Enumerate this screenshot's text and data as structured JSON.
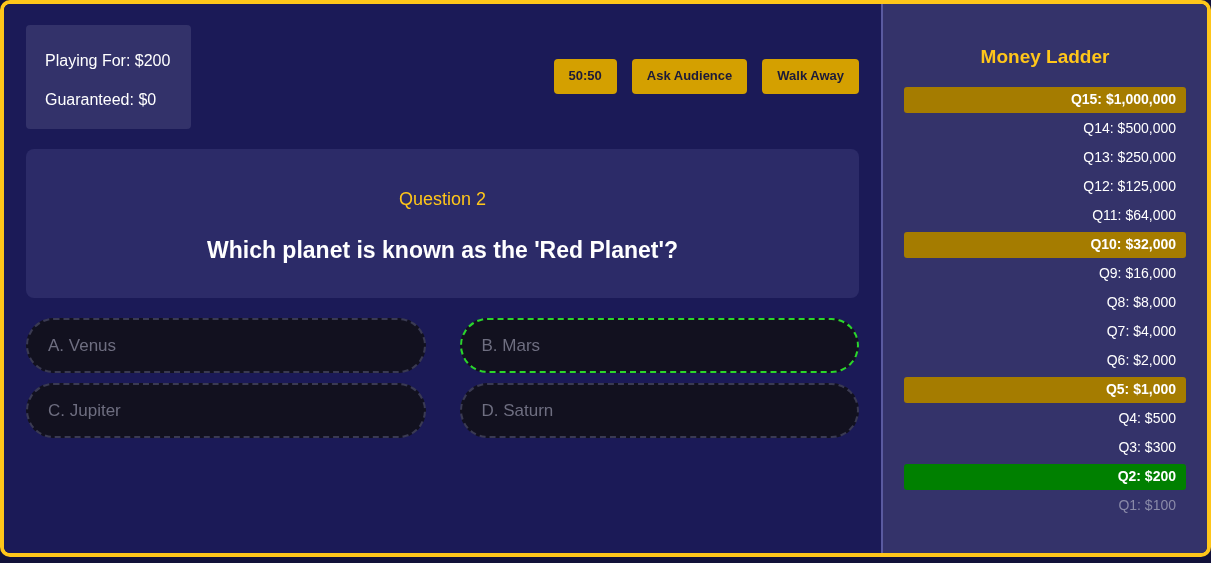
{
  "status": {
    "playing_for": "Playing For: $200",
    "guaranteed": "Guaranteed: $0"
  },
  "lifelines": [
    {
      "label": "50:50",
      "disabled": false
    },
    {
      "label": "Ask Audience",
      "disabled": false
    },
    {
      "label": "Walk Away",
      "disabled": false
    }
  ],
  "question": {
    "number": "Question 2",
    "text": "Which planet is known as the 'Red Planet'?"
  },
  "answers": [
    {
      "label": "A. Venus",
      "disabled": true,
      "selected": false
    },
    {
      "label": "B. Mars",
      "disabled": true,
      "selected": true
    },
    {
      "label": "C. Jupiter",
      "disabled": true,
      "selected": false
    },
    {
      "label": "D. Saturn",
      "disabled": true,
      "selected": false
    }
  ],
  "ladder": {
    "title": "Money Ladder",
    "items": [
      {
        "label": "Q15: $1,000,000",
        "kind": "milestone"
      },
      {
        "label": "Q14: $500,000",
        "kind": "normal"
      },
      {
        "label": "Q13: $250,000",
        "kind": "normal"
      },
      {
        "label": "Q12: $125,000",
        "kind": "normal"
      },
      {
        "label": "Q11: $64,000",
        "kind": "normal"
      },
      {
        "label": "Q10: $32,000",
        "kind": "milestone"
      },
      {
        "label": "Q9: $16,000",
        "kind": "normal"
      },
      {
        "label": "Q8: $8,000",
        "kind": "normal"
      },
      {
        "label": "Q7: $4,000",
        "kind": "normal"
      },
      {
        "label": "Q6: $2,000",
        "kind": "normal"
      },
      {
        "label": "Q5: $1,000",
        "kind": "milestone"
      },
      {
        "label": "Q4: $500",
        "kind": "normal"
      },
      {
        "label": "Q3: $300",
        "kind": "normal"
      },
      {
        "label": "Q2: $200",
        "kind": "current"
      },
      {
        "label": "Q1: $100",
        "kind": "passed"
      }
    ]
  }
}
